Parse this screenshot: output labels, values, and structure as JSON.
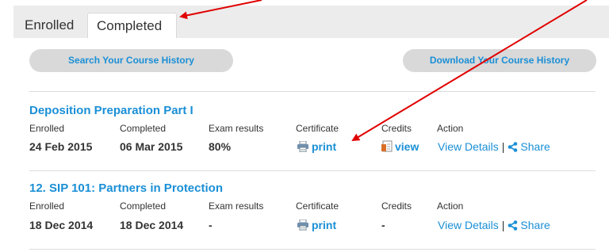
{
  "tabs": {
    "enrolled": "Enrolled",
    "completed": "Completed"
  },
  "actions": {
    "search_label": "Search Your Course History",
    "download_label": "Download Your Course History"
  },
  "columns": {
    "enrolled": "Enrolled",
    "completed": "Completed",
    "exam": "Exam results",
    "certificate": "Certificate",
    "credits": "Credits",
    "action": "Action"
  },
  "courses": [
    {
      "title": "Deposition Preparation Part I",
      "enrolled": "24 Feb 2015",
      "completed": "06 Mar 2015",
      "exam": "80%",
      "certificate": "print",
      "credits": "view",
      "view_details": "View Details",
      "separator": "|",
      "share": "Share"
    },
    {
      "title": "12. SIP 101: Partners in Protection",
      "enrolled": "18 Dec 2014",
      "completed": "18 Dec 2014",
      "exam": "-",
      "certificate": "print",
      "credits": "-",
      "view_details": "View Details",
      "separator": "|",
      "share": "Share"
    }
  ],
  "colors": {
    "link": "#1a8fd6",
    "annotation_arrow": "#e00000",
    "tab_bar": "#ececec"
  },
  "icons": [
    "printer-icon",
    "document-icon",
    "share-icon"
  ]
}
